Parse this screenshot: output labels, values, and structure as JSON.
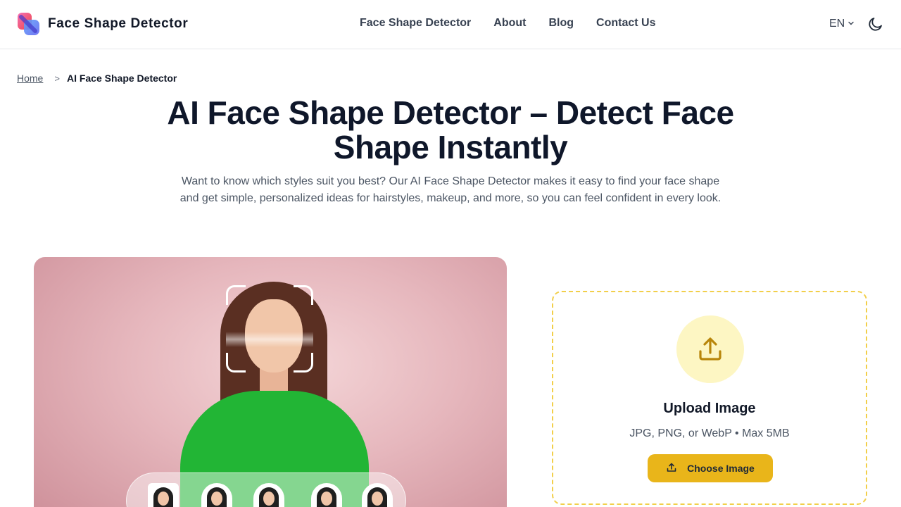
{
  "brand": {
    "name": "Face Shape Detector",
    "logo_icon": "gradient-shape-logo"
  },
  "nav": {
    "items": [
      {
        "label": "Face Shape Detector"
      },
      {
        "label": "About"
      },
      {
        "label": "Blog"
      },
      {
        "label": "Contact Us"
      }
    ]
  },
  "header": {
    "language": "EN",
    "theme_icon": "moon-icon"
  },
  "breadcrumb": {
    "home": "Home",
    "separator": ">",
    "current": "AI Face Shape Detector"
  },
  "hero": {
    "title": "AI Face Shape Detector – Detect Face Shape Instantly",
    "subtitle": "Want to know which styles suit you best? Our AI Face Shape Detector makes it easy to find your face shape and get simple, personalized ideas for hairstyles, makeup, and more, so you can feel confident in every look."
  },
  "upload": {
    "title": "Upload Image",
    "hint": "JPG, PNG, or WebP • Max 5MB",
    "button_label": "Choose Image",
    "icon": "upload-icon"
  },
  "colors": {
    "accent": "#e9b51a",
    "accent_light": "#fdf6c3",
    "dashed_border": "#f2cf4a",
    "text_dark": "#0f172a"
  }
}
